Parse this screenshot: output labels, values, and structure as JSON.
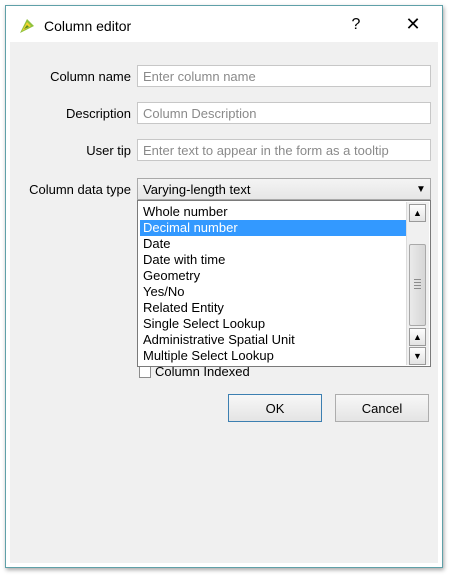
{
  "window": {
    "title": "Column editor",
    "help_glyph": "?",
    "close_glyph": "✕",
    "icon": "qgis-icon"
  },
  "form": {
    "column_name": {
      "label": "Column name",
      "placeholder": "Enter column name",
      "value": ""
    },
    "description": {
      "label": "Description",
      "placeholder": "Column Description",
      "value": ""
    },
    "user_tip": {
      "label": "User tip",
      "placeholder": "Enter text to appear in the form as a tooltip",
      "value": ""
    },
    "data_type": {
      "label": "Column data type",
      "selected": "Varying-length text",
      "arrow_icon": "chevron-down-icon",
      "options": [
        {
          "label": "Whole number",
          "highlighted": false
        },
        {
          "label": "Decimal number",
          "highlighted": true
        },
        {
          "label": "Date",
          "highlighted": false
        },
        {
          "label": "Date with time",
          "highlighted": false
        },
        {
          "label": "Geometry",
          "highlighted": false
        },
        {
          "label": "Yes/No",
          "highlighted": false
        },
        {
          "label": "Related Entity",
          "highlighted": false
        },
        {
          "label": "Single Select Lookup",
          "highlighted": false
        },
        {
          "label": "Administrative Spatial Unit",
          "highlighted": false
        },
        {
          "label": "Multiple Select Lookup",
          "highlighted": false
        }
      ]
    },
    "indexed": {
      "label": "Column Indexed",
      "checked": false
    }
  },
  "buttons": {
    "ok": "OK",
    "cancel": "Cancel"
  },
  "colors": {
    "selection": "#3399ff",
    "frame_border": "#5fa0a8",
    "dialog_bg": "#f0f0f0"
  }
}
